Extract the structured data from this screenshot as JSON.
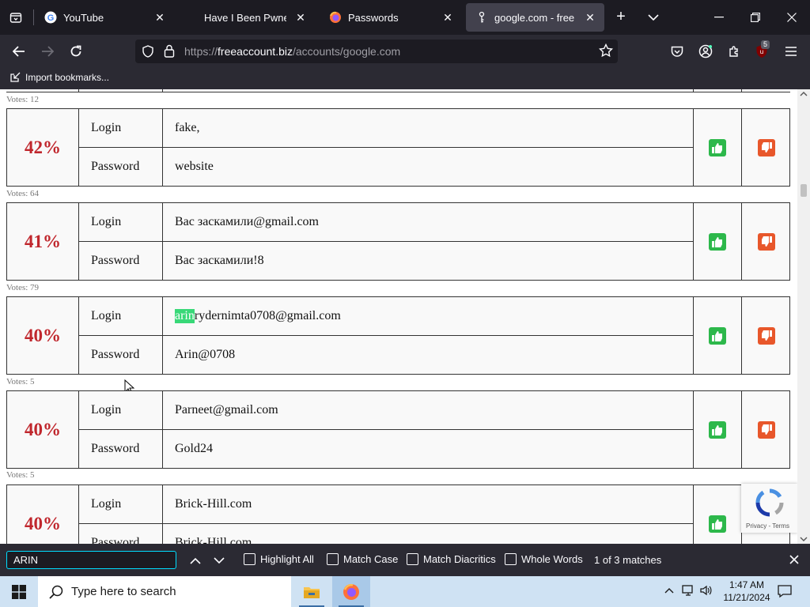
{
  "tabs": [
    {
      "title": "YouTube",
      "favicon": "google-g-icon"
    },
    {
      "title": "Have I Been Pwned: Pwned",
      "favicon": "none"
    },
    {
      "title": "Passwords",
      "favicon": "firefox-icon"
    },
    {
      "title": "google.com - free acco",
      "favicon": "key-icon",
      "active": true
    }
  ],
  "address_bar": {
    "url_prefix": "https://",
    "url_host": "freeaccount.biz",
    "url_path": "/accounts/google.com"
  },
  "toolbar": {
    "extension_badge": "5"
  },
  "bookmarks": {
    "import_label": "Import bookmarks..."
  },
  "credentials": [
    {
      "votes_label": "Votes: 12",
      "percent": "42%",
      "login_label": "Login",
      "login": "fake,",
      "password_label": "Password",
      "password": "website"
    },
    {
      "votes_label": "Votes: 64",
      "percent": "41%",
      "login_label": "Login",
      "login": "Вас заскамили@gmail.com",
      "password_label": "Password",
      "password": "Вас заскамили!8"
    },
    {
      "votes_label": "Votes: 79",
      "percent": "40%",
      "login_label": "Login",
      "login_highlight": "arin",
      "login_rest": "rydernimta0708@gmail.com",
      "password_label": "Password",
      "password": "Arin@0708"
    },
    {
      "votes_label": "Votes: 5",
      "percent": "40%",
      "login_label": "Login",
      "login": "Parneet@gmail.com",
      "password_label": "Password",
      "password": "Gold24"
    },
    {
      "votes_label": "Votes: 5",
      "percent": "40%",
      "login_label": "Login",
      "login": "Brick-Hill.com",
      "password_label": "Password",
      "password": "Brick-Hill.com"
    }
  ],
  "recaptcha": {
    "privacy": "Privacy - Terms"
  },
  "find_bar": {
    "query": "ARIN",
    "highlight_all": "Highlight All",
    "match_case": "Match Case",
    "match_diacritics": "Match Diacritics",
    "whole_words": "Whole Words",
    "matches": "1 of 3 matches"
  },
  "taskbar": {
    "search_placeholder": "Type here to search",
    "time": "1:47 AM",
    "date": "11/21/2024"
  },
  "colors": {
    "percent_red": "#c0272d",
    "thumb_up_green": "#2db84b",
    "thumb_down_orange": "#e8572b",
    "find_highlight": "#38d878"
  }
}
